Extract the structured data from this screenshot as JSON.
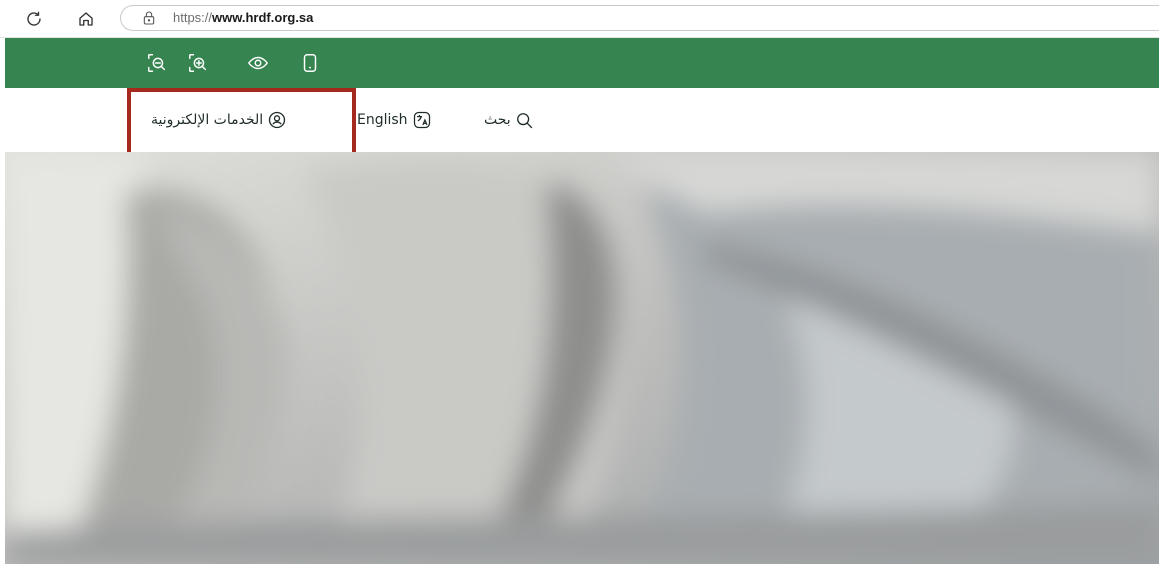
{
  "browser": {
    "url_prefix": "https://",
    "url_host": "www.hrdf.org.sa",
    "icons": [
      "reload-icon",
      "home-icon",
      "lock-icon"
    ]
  },
  "accessibility_bar": {
    "color": "#368551",
    "icons": [
      "zoom-out-icon",
      "zoom-in-icon",
      "eye-icon",
      "contrast-icon"
    ]
  },
  "header": {
    "eservices_label": "الخدمات الإلكترونية",
    "language_label": "English",
    "search_label": "بحث",
    "icons": [
      "user-circle-icon",
      "translate-icon",
      "search-icon"
    ]
  },
  "highlight": {
    "color": "#a52a1d"
  },
  "hero": {
    "description_icon": "hero-image"
  }
}
